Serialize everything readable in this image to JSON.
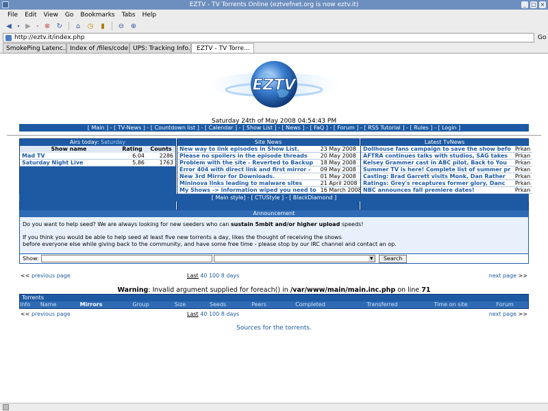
{
  "window": {
    "title": "EZTV - TV Torrents Online (eztvefnet.org is now eztv.it)"
  },
  "menu": [
    "File",
    "Edit",
    "View",
    "Go",
    "Bookmarks",
    "Tabs",
    "Help"
  ],
  "url": {
    "value": "http://eztv.it/index.php",
    "go_label": "Go"
  },
  "tabs": [
    {
      "label": "SmokePing Latenc..."
    },
    {
      "label": "Index of /files/code"
    },
    {
      "label": "UPS: Tracking Info..."
    },
    {
      "label": "EZTV - TV Torre..."
    }
  ],
  "page": {
    "logo_text": "EZTV",
    "datetime": "Saturday 24th of May 2008 04:54:43 PM",
    "nav": "[ Main ] - [ TV-News ] - [ Countdown list ] - [ Calendar ] - [ Show List ] - [ News ] - [ FaQ ] - [ Forum ] - [ RSS Tutorial ] - [ Rules ] - [ Login ]",
    "airs_today": {
      "title": "Airs today:",
      "day": "Saturday",
      "headers": [
        "Show name",
        "Rating",
        "Counts"
      ],
      "rows": [
        {
          "name": "Mad TV",
          "rating": "6.04",
          "counts": "2286"
        },
        {
          "name": "Saturday Night Live",
          "rating": "5.86",
          "counts": "1763"
        }
      ]
    },
    "site_news": {
      "title": "Site News",
      "rows": [
        {
          "title": "New way to link episodes in Show List.",
          "date": "23 May 2008"
        },
        {
          "title": "Please no spoilers in the episode threads",
          "date": "20 May 2008"
        },
        {
          "title": "Problem with the site - Reverted to Backup",
          "date": "18 May 2008"
        },
        {
          "title": "Error 404 with direct link and first mirror -",
          "date": "09 May 2008"
        },
        {
          "title": "New 3rd Mirror for Downloads.",
          "date": "01 May 2008"
        },
        {
          "title": "Mininova links leading to malware sites",
          "date": "21 April 2008"
        },
        {
          "title": "My Shows -> information wiped you need to",
          "date": "16 March 2008"
        }
      ]
    },
    "tv_news": {
      "title": "Latest TvNews",
      "rows": [
        {
          "title": "Dollhouse fans campaign to save the show befo",
          "author": "Prkan"
        },
        {
          "title": "AFTRA continues talks with studios, SAG takes",
          "author": "Prkan"
        },
        {
          "title": "Kelsey Grammer cast in ABC pilot, Back to You",
          "author": "Prkan"
        },
        {
          "title": "Summer TV is here! Complete list of summer pr",
          "author": "Prkan"
        },
        {
          "title": "Casting: Brad Garrett visits Monk, Dan Rather",
          "author": "Prkan"
        },
        {
          "title": "Ratings: Grey's recaptures former glory, Danc",
          "author": "Prkan"
        },
        {
          "title": "NBC announces fall premiere dates!",
          "author": "Prkan"
        }
      ]
    },
    "styles": "[ Main style] - [ CTUStyle ] - [ BlackDiamond ]",
    "announcement": {
      "title": "Announcement",
      "line1_pre": "Do you want to help seed? We are always looking for new seeders who can ",
      "line1_bold": "sustain 5mbit and/or higher upload",
      "line1_post": " speeds!",
      "line2": "If you think you would be able to help seed at least five new torrents a day, likes the thought of receiving the shows",
      "line3": "before everyone else while giving back to the community, and have some free time - please stop by our IRC channel and contact an op."
    },
    "search": {
      "label": "Show:",
      "button": "Search"
    },
    "pager": {
      "prev_arrows": "<<",
      "prev": "previous page",
      "last_label": "Last",
      "last_links": "40 100 8 days",
      "next": "next page",
      "next_arrows": ">>"
    },
    "warning": {
      "bold": "Warning",
      "text1": ": Invalid argument supplied for foreach() in ",
      "path": "/var/www/main/main.inc.php",
      "text2": " on line ",
      "line": "71"
    },
    "torrents": {
      "title": "Torrents",
      "columns": [
        "Info",
        "Name",
        "Mirrors",
        "Group",
        "Size",
        "Seeds",
        "Peers",
        "Completed",
        "Transferred",
        "Time on site",
        "Forum"
      ]
    },
    "sources": "Sources for the torrents."
  }
}
